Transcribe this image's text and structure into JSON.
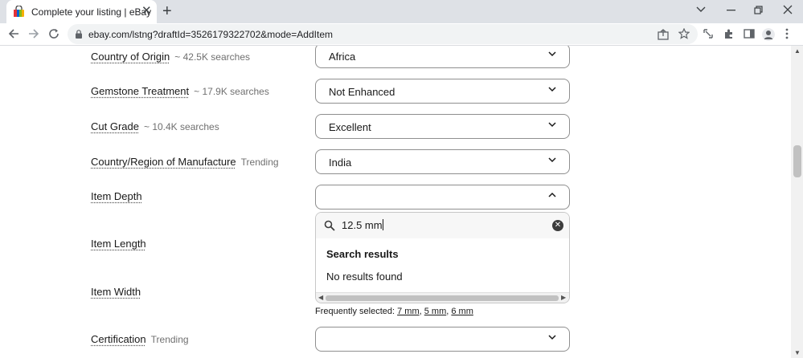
{
  "browser": {
    "tab_title": "Complete your listing | eBay",
    "tab_close": "✕",
    "new_tab": "+",
    "url": "ebay.com/lstng?draftId=3526179322702&mode=AddItem"
  },
  "form": {
    "rows": [
      {
        "label": "Country of Origin",
        "meta": "~ 42.5K searches",
        "value": "Africa"
      },
      {
        "label": "Gemstone Treatment",
        "meta": "~ 17.9K searches",
        "value": "Not Enhanced"
      },
      {
        "label": "Cut Grade",
        "meta": "~ 10.4K searches",
        "value": "Excellent"
      },
      {
        "label": "Country/Region of Manufacture",
        "meta": "Trending",
        "value": "India"
      },
      {
        "label": "Item Depth",
        "meta": "",
        "value": ""
      },
      {
        "label": "Item Length",
        "meta": ""
      },
      {
        "label": "Item Width",
        "meta": ""
      },
      {
        "label": "Certification",
        "meta": "Trending",
        "value": ""
      }
    ],
    "depth_dropdown": {
      "search_value": "12.5 mm",
      "results_heading": "Search results",
      "no_results": "No results found"
    },
    "frequently_selected": {
      "label": "Frequently selected:",
      "options": [
        "7 mm",
        "5 mm",
        "6 mm"
      ]
    }
  },
  "colors": {
    "accent": "#3665f3",
    "text": "#191919",
    "muted": "#707070"
  }
}
